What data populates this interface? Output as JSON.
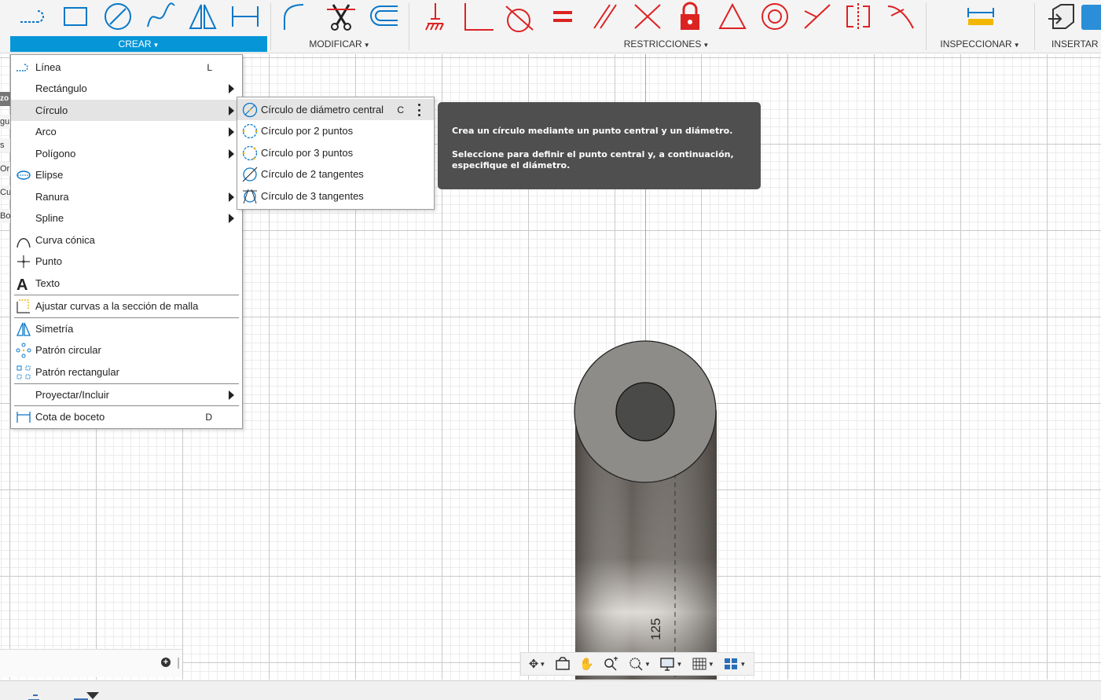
{
  "toolbar": {
    "groups": {
      "crear": "CREAR",
      "modificar": "MODIFICAR",
      "restricciones": "RESTRICCIONES",
      "inspeccionar": "INSPECCIONAR",
      "insertar": "INSERTAR"
    },
    "accent_color": "#0696d7"
  },
  "crear_menu": {
    "items": [
      {
        "label": "Línea",
        "shortcut": "L",
        "icon": "line-icon"
      },
      {
        "label": "Rectángulo",
        "icon": "rectangle-icon",
        "submenu": true
      },
      {
        "label": "Círculo",
        "icon": "circle-icon",
        "submenu": true,
        "hovered": true
      },
      {
        "label": "Arco",
        "icon": "arc-icon",
        "submenu": true
      },
      {
        "label": "Polígono",
        "icon": "polygon-icon",
        "submenu": true
      },
      {
        "label": "Elipse",
        "icon": "ellipse-icon"
      },
      {
        "label": "Ranura",
        "icon": "slot-icon",
        "submenu": true
      },
      {
        "label": "Spline",
        "icon": "spline-icon",
        "submenu": true
      },
      {
        "label": "Curva cónica",
        "icon": "conic-curve-icon"
      },
      {
        "label": "Punto",
        "icon": "point-icon"
      },
      {
        "label": "Texto",
        "icon": "text-icon"
      },
      {
        "label": "Ajustar curvas a la sección de malla",
        "icon": "fit-curves-icon"
      },
      {
        "label": "Simetría",
        "icon": "mirror-icon"
      },
      {
        "label": "Patrón circular",
        "icon": "circular-pattern-icon"
      },
      {
        "label": "Patrón rectangular",
        "icon": "rectangular-pattern-icon"
      },
      {
        "label": "Proyectar/Incluir",
        "icon": "project-icon",
        "submenu": true
      },
      {
        "label": "Cota de boceto",
        "shortcut": "D",
        "icon": "sketch-dimension-icon"
      }
    ]
  },
  "circle_submenu": {
    "items": [
      {
        "label": "Círculo de diámetro central",
        "shortcut": "C",
        "hovered": true
      },
      {
        "label": "Círculo por 2 puntos"
      },
      {
        "label": "Círculo por 3 puntos"
      },
      {
        "label": "Círculo de 2 tangentes"
      },
      {
        "label": "Círculo de 3 tangentes"
      }
    ]
  },
  "tooltip": {
    "line1": "Crea un círculo mediante un punto central y un diámetro.",
    "line2": "Seleccione para definir el punto central y, a continuación, especifique el diámetro."
  },
  "canvas": {
    "dimension_label": "125"
  },
  "side_panel": {
    "fragments": [
      "zo",
      "gu",
      "s g",
      "Or",
      "Cu",
      "Bo"
    ]
  }
}
